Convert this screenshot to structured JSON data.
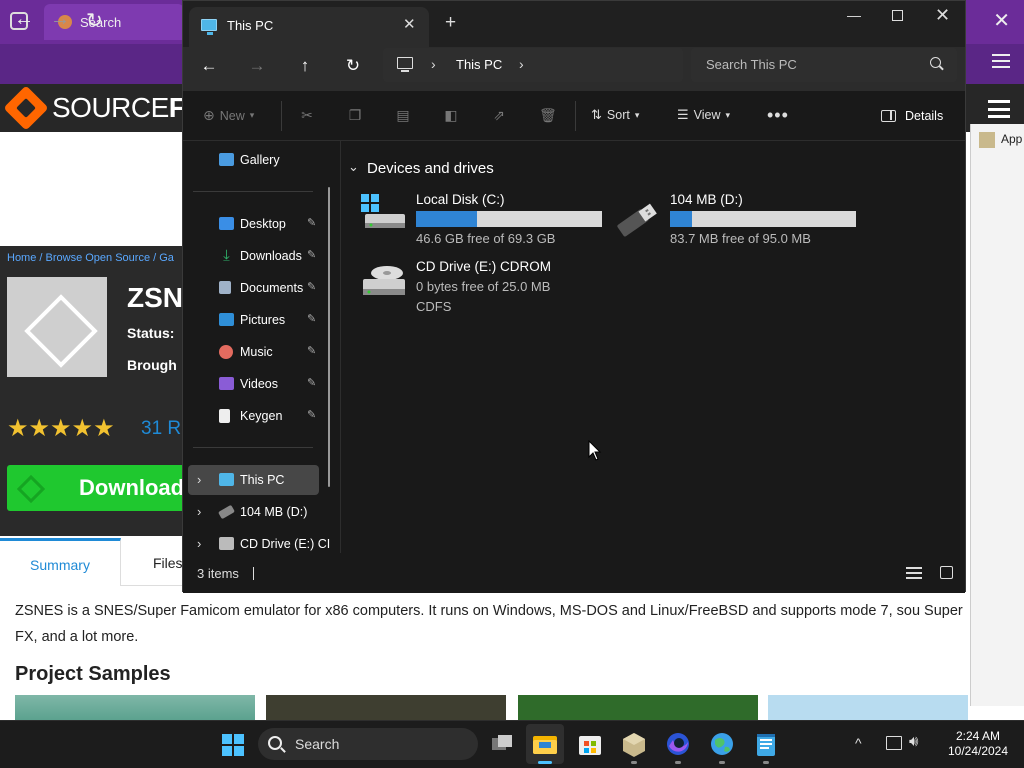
{
  "browser": {
    "tab_title": "Search",
    "close_glyph": "✕"
  },
  "sourceforge": {
    "logo_light": "SOURCE",
    "logo_bold": "FO",
    "breadcrumb": "Home / Browse Open Source / Ga",
    "project_title": "ZSN",
    "status_label": "Status: ",
    "brought_label": "Brough",
    "stars": "★★★★★",
    "rating_text": "31 R",
    "download_label": "Download",
    "tabs": {
      "summary": "Summary",
      "files": "Files"
    },
    "description": "ZSNES is a SNES/Super Famicom emulator for x86 computers. It runs on Windows, MS-DOS and Linux/FreeBSD and supports mode 7, sou Super FX, and a lot more.",
    "samples_title": "Project Samples",
    "right_app_label": "App"
  },
  "explorer": {
    "tab_title": "This PC",
    "tab_close": "✕",
    "new_tab": "+",
    "window_controls": {
      "minimize": "—",
      "close": "✕"
    },
    "nav": {
      "back": "←",
      "forward": "→",
      "up": "↑",
      "refresh": "↻"
    },
    "address": {
      "crumb": "This PC",
      "chevron": "›"
    },
    "search_placeholder": "Search This PC",
    "commands": {
      "new": "New",
      "sort": "Sort",
      "view": "View",
      "more": "•••",
      "details": "Details"
    },
    "sidebar": {
      "gallery": "Gallery",
      "quick_access": [
        {
          "label": "Desktop",
          "icon": "desktop-icon",
          "color": "#3a8ee6"
        },
        {
          "label": "Downloads",
          "icon": "download-icon",
          "color": "#2fb36b"
        },
        {
          "label": "Documents",
          "icon": "document-icon",
          "color": "#9fb2c8"
        },
        {
          "label": "Pictures",
          "icon": "pictures-icon",
          "color": "#2f8fd8"
        },
        {
          "label": "Music",
          "icon": "music-icon",
          "color": "#e36b5f"
        },
        {
          "label": "Videos",
          "icon": "videos-icon",
          "color": "#8a5cd6"
        },
        {
          "label": "Keygen",
          "icon": "file-icon",
          "color": "#eeeeee"
        }
      ],
      "pin_glyph": "📌",
      "tree": [
        {
          "label": "This PC",
          "icon": "this-pc-icon"
        },
        {
          "label": "104 MB (D:)",
          "icon": "usb-drive-icon"
        },
        {
          "label": "CD Drive (E:) CI",
          "icon": "cd-drive-icon"
        }
      ]
    },
    "content": {
      "group_title": "Devices and drives",
      "drives": [
        {
          "name": "Local Disk (C:)",
          "free_text": "46.6 GB free of 69.3 GB",
          "used_fraction": 0.33,
          "icon": "local-disk-icon"
        },
        {
          "name": "104 MB (D:)",
          "free_text": "83.7 MB free of 95.0 MB",
          "used_fraction": 0.12,
          "icon": "usb-drive-icon"
        },
        {
          "name": "CD Drive (E:) CDROM",
          "free_text": "0 bytes free of 25.0 MB",
          "fs_text": "CDFS",
          "icon": "cd-drive-icon"
        }
      ]
    },
    "status": {
      "items": "3 items"
    }
  },
  "taskbar": {
    "search_label": "Search",
    "clock_time": "2:24 AM",
    "clock_date": "10/24/2024",
    "tray_up": "^"
  },
  "colors": {
    "accent": "#2f84d4",
    "win_blue": "#4cc2ff",
    "browser_purple": "#6b2c99",
    "sf_orange": "#ff6600",
    "sf_green": "#1fc82f"
  }
}
